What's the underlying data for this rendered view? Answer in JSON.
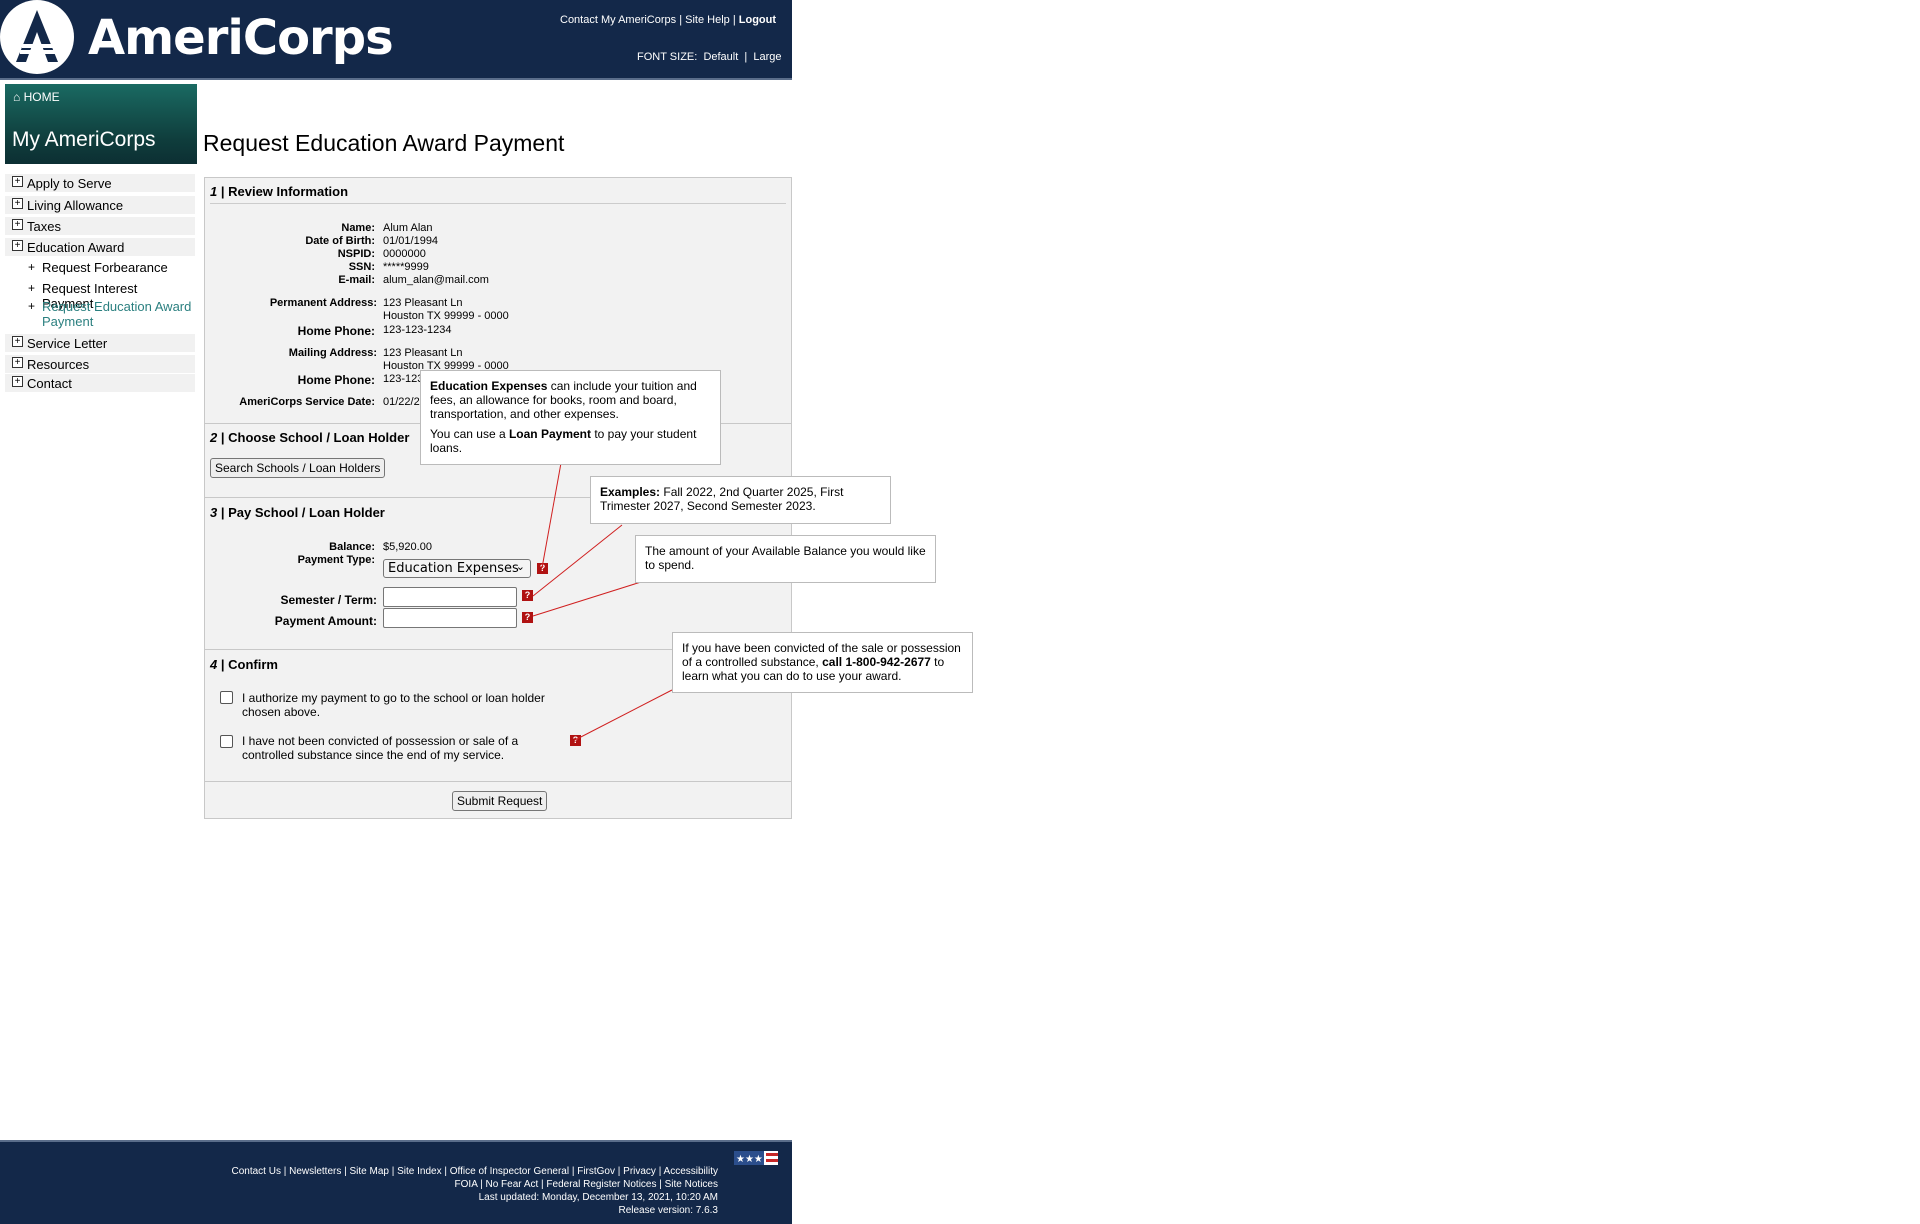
{
  "header": {
    "logo_text": "AmeriCorps",
    "links": [
      "Contact My AmeriCorps",
      "Site Help",
      "Logout"
    ],
    "font_size_label": "FONT SIZE:",
    "font_size_default": "Default",
    "font_size_large": "Large"
  },
  "sidebar": {
    "home": "HOME",
    "title": "My AmeriCorps",
    "items": [
      {
        "label": "Apply to Serve"
      },
      {
        "label": "Living Allowance"
      },
      {
        "label": "Taxes"
      },
      {
        "label": "Education Award"
      },
      {
        "label": "Service Letter"
      },
      {
        "label": "Resources"
      },
      {
        "label": "Contact"
      }
    ],
    "sub_items": [
      {
        "label": "Request Forbearance"
      },
      {
        "label": "Request Interest Payment"
      },
      {
        "label": "Request Education Award Payment"
      }
    ]
  },
  "page_title": "Request Education Award Payment",
  "sections": {
    "s1_num": "1",
    "s1_title": "| Review Information",
    "s2_num": "2",
    "s2_title": "| Choose School / Loan Holder",
    "s3_num": "3",
    "s3_title": "| Pay School / Loan Holder",
    "s4_num": "4",
    "s4_title": "| Confirm"
  },
  "review": {
    "name_label": "Name:",
    "name": "Alum Alan",
    "dob_label": "Date of Birth:",
    "dob": "01/01/1994",
    "nspid_label": "NSPID:",
    "nspid": "0000000",
    "ssn_label": "SSN:",
    "ssn": "*****9999",
    "email_label": "E-mail:",
    "email": "alum_alan@mail.com",
    "perm_label": "Permanent Address:",
    "perm_line1": "123 Pleasant Ln",
    "perm_line2": "Houston TX 99999 - 0000",
    "home_phone_label": "Home Phone:",
    "home_phone": "123-123-1234",
    "mail_label": "Mailing Address:",
    "mail_line1": "123 Pleasant Ln",
    "mail_line2": "Houston TX 99999 - 0000",
    "home_phone2_label": "Home Phone:",
    "home_phone2": "123-123",
    "service_label": "AmeriCorps Service Date:",
    "service_date": "01/22/2"
  },
  "choose": {
    "search_button": "Search Schools / Loan Holders"
  },
  "pay": {
    "balance_label": "Balance:",
    "balance": "$5,920.00",
    "payment_type_label": "Payment Type:",
    "payment_type": "Education Expenses",
    "semester_label": "Semester / Term:",
    "semester_value": "",
    "amount_label": "Payment Amount:",
    "amount_value": ""
  },
  "confirm": {
    "authorize": "I authorize my payment to go to the school or loan holder chosen above.",
    "not_convicted": "I have not been convicted of possession or sale of a controlled substance since the end of my service.",
    "submit": "Submit Request"
  },
  "tooltips": {
    "edu_bold": "Education Expenses",
    "edu_rest": " can include your tuition and fees, an allowance for books, room and board, transportation, and other expenses.",
    "loan_pre": "You can use a ",
    "loan_bold": "Loan Payment",
    "loan_rest": " to pay your student loans.",
    "examples_bold": "Examples:",
    "examples_rest": " Fall 2022, 2nd Quarter 2025, First Trimester 2027, Second Semester 2023.",
    "amount_tip": "The amount of your Available Balance you would like to spend.",
    "conv_pre": "If you have been convicted of the sale or possession of a controlled substance, ",
    "conv_bold": "call 1-800-942-2677",
    "conv_rest": " to learn what you can do to use your award."
  },
  "footer": {
    "line1": "Contact Us | Newsletters | Site Map | Site Index | Office of Inspector General | FirstGov | Privacy | Accessibility",
    "line2": "FOIA | No Fear Act | Federal Register Notices | Site Notices",
    "line3": "Last updated: Monday, December 13, 2021, 10:20 AM",
    "line4": "Release version: 7.6.3"
  },
  "colors": {
    "header_bg": "#132849",
    "accent_teal": "#2a7f7f",
    "help_red": "#b01212"
  }
}
